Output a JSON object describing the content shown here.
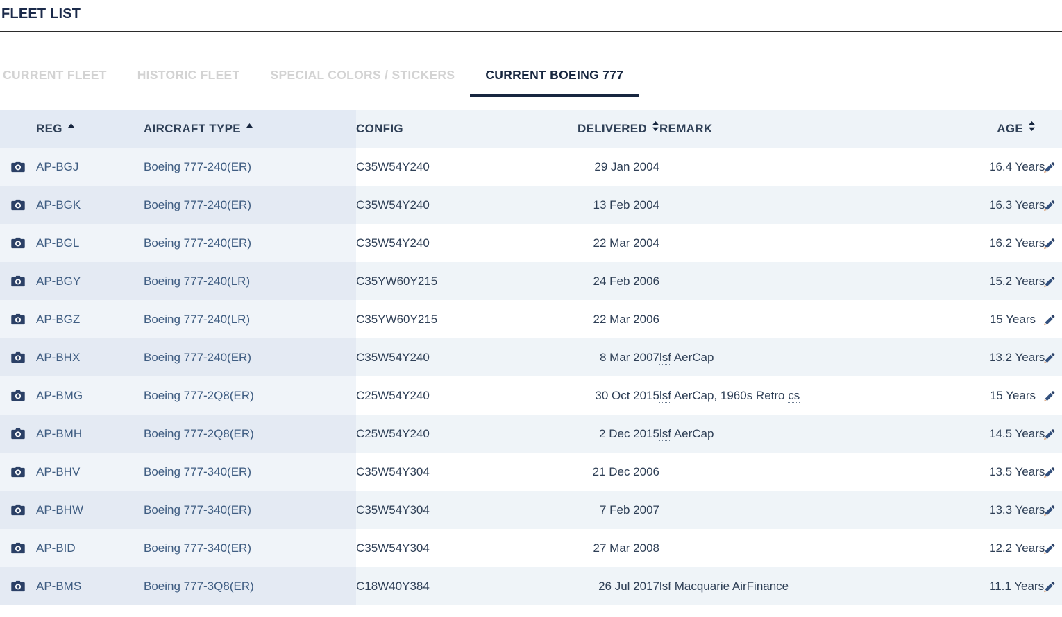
{
  "header": {
    "title": "FLEET LIST"
  },
  "tabs": [
    {
      "label": "CURRENT FLEET",
      "active": false
    },
    {
      "label": "HISTORIC FLEET",
      "active": false
    },
    {
      "label": "SPECIAL COLORS / STICKERS",
      "active": false
    },
    {
      "label": "CURRENT BOEING 777",
      "active": true
    }
  ],
  "table": {
    "columns": [
      {
        "key": "camera",
        "label": "",
        "sort": "none",
        "align": "center"
      },
      {
        "key": "reg",
        "label": "REG",
        "sort": "asc",
        "align": "left"
      },
      {
        "key": "type",
        "label": "AIRCRAFT TYPE",
        "sort": "asc",
        "align": "left"
      },
      {
        "key": "config",
        "label": "CONFIG",
        "sort": "none",
        "align": "left"
      },
      {
        "key": "delivered",
        "label": "DELIVERED",
        "sort": "both",
        "align": "right"
      },
      {
        "key": "remark",
        "label": "REMARK",
        "sort": "none",
        "align": "left"
      },
      {
        "key": "age",
        "label": "AGE",
        "sort": "both",
        "align": "right"
      },
      {
        "key": "edit",
        "label": "",
        "sort": "none",
        "align": "center"
      }
    ],
    "icons": {
      "camera": "camera-icon",
      "edit": "pencil-icon",
      "sort_asc": "sort-ascending-icon",
      "sort_both": "sort-both-icon"
    },
    "rows": [
      {
        "reg": "AP-BGJ",
        "type": "Boeing 777-240(ER)",
        "config": "C35W54Y240",
        "delivered": "29 Jan 2004",
        "remark": "",
        "remark_abbr": [],
        "age": "16.4 Years"
      },
      {
        "reg": "AP-BGK",
        "type": "Boeing 777-240(ER)",
        "config": "C35W54Y240",
        "delivered": "13 Feb 2004",
        "remark": "",
        "remark_abbr": [],
        "age": "16.3 Years"
      },
      {
        "reg": "AP-BGL",
        "type": "Boeing 777-240(ER)",
        "config": "C35W54Y240",
        "delivered": "22 Mar 2004",
        "remark": "",
        "remark_abbr": [],
        "age": "16.2 Years"
      },
      {
        "reg": "AP-BGY",
        "type": "Boeing 777-240(LR)",
        "config": "C35YW60Y215",
        "delivered": "24 Feb 2006",
        "remark": "",
        "remark_abbr": [],
        "age": "15.2 Years"
      },
      {
        "reg": "AP-BGZ",
        "type": "Boeing 777-240(LR)",
        "config": "C35YW60Y215",
        "delivered": "22 Mar 2006",
        "remark": "",
        "remark_abbr": [],
        "age": "15 Years"
      },
      {
        "reg": "AP-BHX",
        "type": "Boeing 777-240(ER)",
        "config": "C35W54Y240",
        "delivered": "8 Mar 2007",
        "remark": "lsf AerCap",
        "remark_abbr": [
          "lsf"
        ],
        "age": "13.2 Years"
      },
      {
        "reg": "AP-BMG",
        "type": "Boeing 777-2Q8(ER)",
        "config": "C25W54Y240",
        "delivered": "30 Oct 2015",
        "remark": "lsf AerCap, 1960s Retro cs",
        "remark_abbr": [
          "lsf",
          "cs"
        ],
        "age": "15 Years"
      },
      {
        "reg": "AP-BMH",
        "type": "Boeing 777-2Q8(ER)",
        "config": "C25W54Y240",
        "delivered": "2 Dec 2015",
        "remark": "lsf AerCap",
        "remark_abbr": [
          "lsf"
        ],
        "age": "14.5 Years"
      },
      {
        "reg": "AP-BHV",
        "type": "Boeing 777-340(ER)",
        "config": "C35W54Y304",
        "delivered": "21 Dec 2006",
        "remark": "",
        "remark_abbr": [],
        "age": "13.5 Years"
      },
      {
        "reg": "AP-BHW",
        "type": "Boeing 777-340(ER)",
        "config": "C35W54Y304",
        "delivered": "7 Feb 2007",
        "remark": "",
        "remark_abbr": [],
        "age": "13.3 Years"
      },
      {
        "reg": "AP-BID",
        "type": "Boeing 777-340(ER)",
        "config": "C35W54Y304",
        "delivered": "27 Mar 2008",
        "remark": "",
        "remark_abbr": [],
        "age": "12.2 Years"
      },
      {
        "reg": "AP-BMS",
        "type": "Boeing 777-3Q8(ER)",
        "config": "C18W40Y384",
        "delivered": "26 Jul 2017",
        "remark": "lsf Macquarie AirFinance",
        "remark_abbr": [
          "lsf"
        ],
        "age": "11.1 Years"
      }
    ]
  },
  "colors": {
    "title": "#1b2a4a",
    "tab_active": "#17263f",
    "tab_inactive": "#d3d3d3",
    "header_bg": "#eef3f8",
    "header_sorted_bg": "#e3eaf4",
    "row_alt_bg": "#eff4f8",
    "link": "#3f5d82",
    "text": "#2e3f56"
  }
}
